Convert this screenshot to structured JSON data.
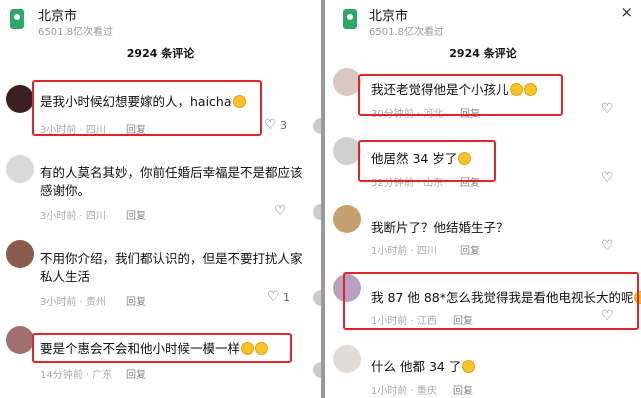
{
  "left": {
    "city": "北京市",
    "views": "6501.8亿次看过",
    "count": "2924 条评论",
    "close_icon": "×",
    "comments": [
      {
        "text": "是我小时候幻想要嫁的人，haicha",
        "meta": "3小时前 · 四川",
        "reply": "回复",
        "likes": "3"
      },
      {
        "text": "有的人莫名其妙，你前任婚后幸福是不是都应该感谢你。",
        "meta": "3小时前 · 四川",
        "reply": "回复",
        "likes": ""
      },
      {
        "text": "不用你介绍，我们都认识的，但是不要打扰人家私人生活",
        "meta": "3小时前 · 贵州",
        "reply": "回复",
        "likes": "1"
      },
      {
        "text": "要是个惠会不会和他小时候一模一样",
        "meta": "14分钟前 · 广东",
        "reply": "回复",
        "likes": ""
      }
    ]
  },
  "right": {
    "city": "北京市",
    "views": "6501.8亿次看过",
    "count": "2924 条评论",
    "close_icon": "×",
    "comments": [
      {
        "text": "我还老觉得他是个小孩儿",
        "meta": "30分钟前 · 河北",
        "reply": "回复",
        "likes": ""
      },
      {
        "text": "他居然 34 岁了",
        "meta": "52分钟前 · 山东",
        "reply": "回复",
        "likes": ""
      },
      {
        "text": "我断片了？他结婚生子？",
        "meta": "1小时前 · 四川",
        "reply": "回复",
        "likes": ""
      },
      {
        "text": "我 87 他 88*怎么我觉得我是看他电视长大的呢",
        "meta": "1小时前 · 江西",
        "reply": "回复",
        "likes": ""
      },
      {
        "text": "什么 他都 34 了",
        "meta": "1小时前 · 重庆",
        "reply": "回复",
        "likes": ""
      }
    ]
  },
  "colors": {
    "highlight": "#e0242b",
    "brand": "#2fa66a"
  }
}
